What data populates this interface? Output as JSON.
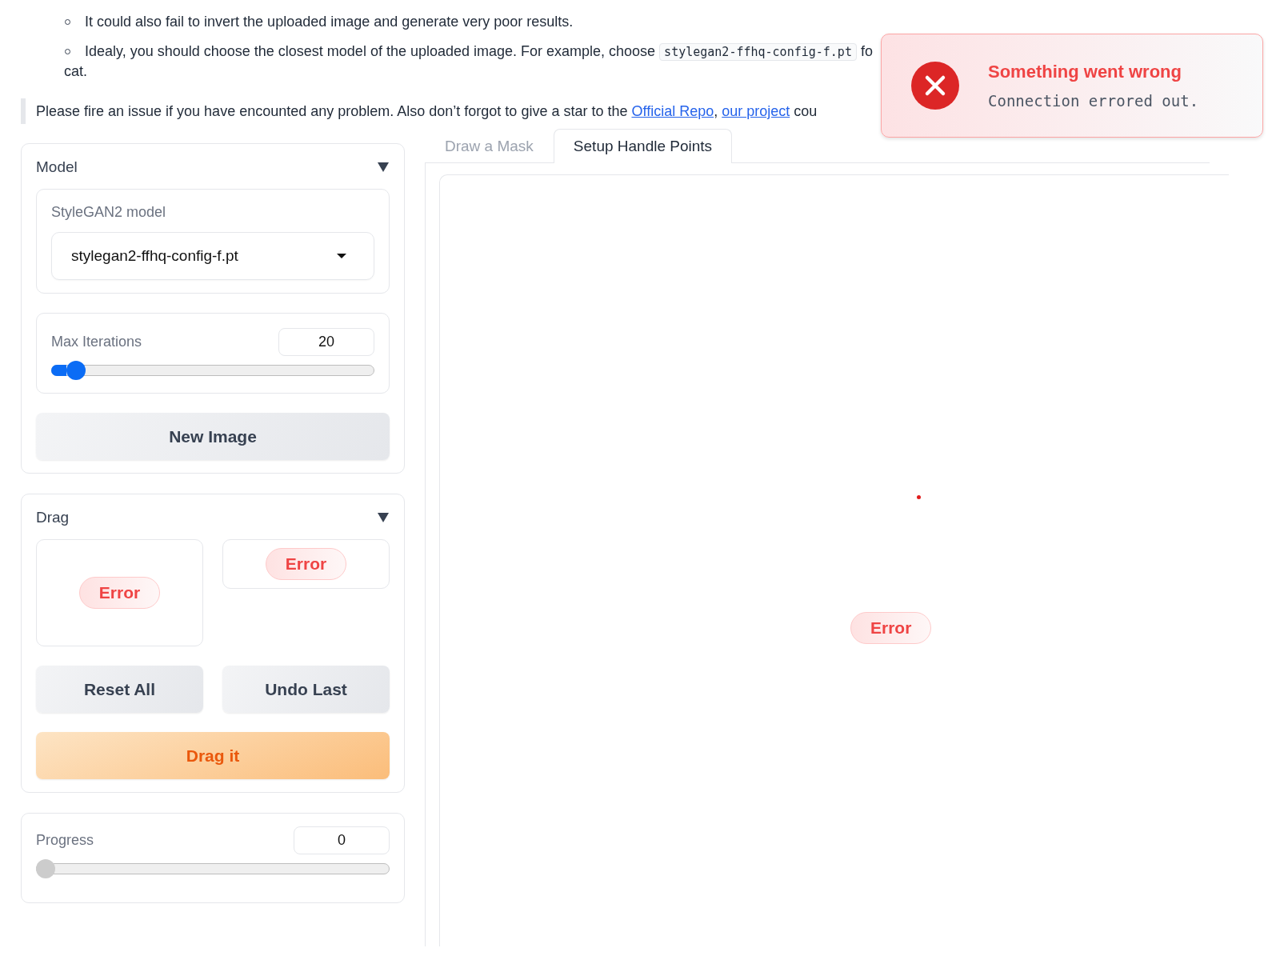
{
  "notes": [
    {
      "text": "It could also fail to invert the uploaded image and generate very poor results."
    },
    {
      "text": "Idealy, you should choose the closest model of the uploaded image. For example, choose ",
      "code": "stylegan2-ffhq-config-f.pt",
      "after": " fo",
      "next_line": "cat."
    }
  ],
  "notice": {
    "text": "Please fire an issue if you have encounted any problem. Also don’t forgot to give a star to the ",
    "links": [
      "Official Repo",
      "our project"
    ],
    "separator": ", ",
    "tail": " cou"
  },
  "toast": {
    "kind": "error",
    "title": "Something went wrong",
    "message": "Connection errored out."
  },
  "model_panel": {
    "title": "Model",
    "expanded": true,
    "dropdown": {
      "label": "StyleGAN2 model",
      "value": "stylegan2-ffhq-config-f.pt"
    },
    "slider": {
      "label": "Max Iterations",
      "value": "20",
      "level": 0.05,
      "disabled": false
    },
    "button": "New Image"
  },
  "drag_panel": {
    "title": "Drag",
    "expanded": true,
    "errors": [
      "Error",
      "Error"
    ],
    "buttons": [
      {
        "label": "Reset All",
        "kind": "secondary"
      },
      {
        "label": "Undo Last",
        "kind": "secondary"
      },
      {
        "label": "Drag it",
        "kind": "primary"
      }
    ]
  },
  "progress": {
    "label": "Progress",
    "value": "0",
    "level": 0,
    "disabled": true
  },
  "tabs": [
    {
      "label": "Draw a Mask",
      "selected": false
    },
    {
      "label": "Setup Handle Points",
      "selected": true
    }
  ],
  "canvas": {
    "error": "Error"
  }
}
